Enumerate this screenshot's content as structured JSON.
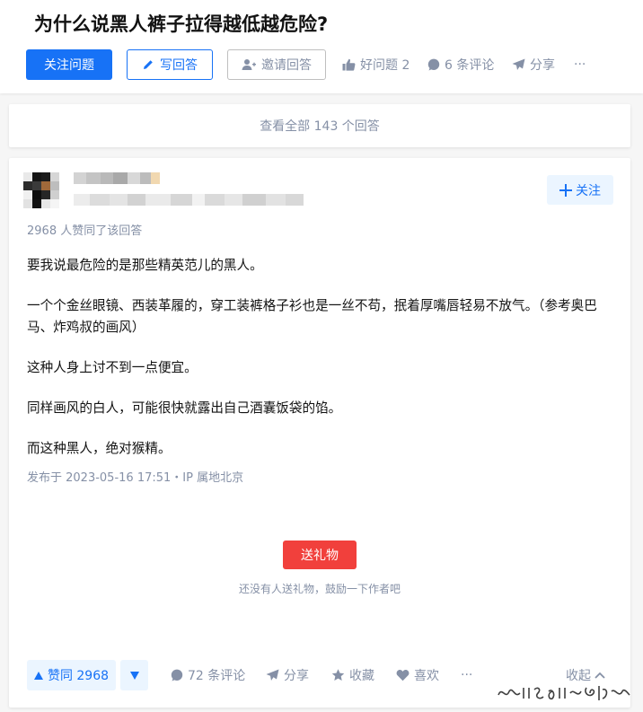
{
  "question": {
    "title": "为什么说黑人裤子拉得越低越危险?",
    "follow_label": "关注问题",
    "write_label": "写回答",
    "invite_label": "邀请回答",
    "good_question_label": "好问题 2",
    "comments_label": "6 条评论",
    "share_label": "分享",
    "more_label": "···"
  },
  "view_all": {
    "label": "查看全部 143 个回答"
  },
  "answer": {
    "follow_author_label": "关注",
    "upvoted_by": "2968 人赞同了该回答",
    "paragraphs": [
      "要我说最危险的是那些精英范儿的黑人。",
      "一个个金丝眼镜、西装革履的，穿工装裤格子衫也是一丝不苟，抿着厚嘴唇轻易不放气。（参考奥巴马、炸鸡叔的画风）",
      "这种人身上讨不到一点便宜。",
      "同样画风的白人，可能很快就露出自己酒囊饭袋的馅。",
      "而这种黑人，绝对猴精。"
    ],
    "published": "发布于 2023-05-16 17:51・IP 属地北京",
    "gift_label": "送礼物",
    "gift_hint": "还没有人送礼物，鼓励一下作者吧",
    "actions": {
      "upvote_label": "赞同 2968",
      "comments_label": "72 条评论",
      "share_label": "分享",
      "favorite_label": "收藏",
      "like_label": "喜欢",
      "more_label": "···",
      "collapse_label": "收起"
    }
  },
  "colors": {
    "brand_blue": "#1772f6",
    "light_blue_bg": "#ebf5ff",
    "gray_text": "#8590a6",
    "gift_red": "#f1403c"
  }
}
